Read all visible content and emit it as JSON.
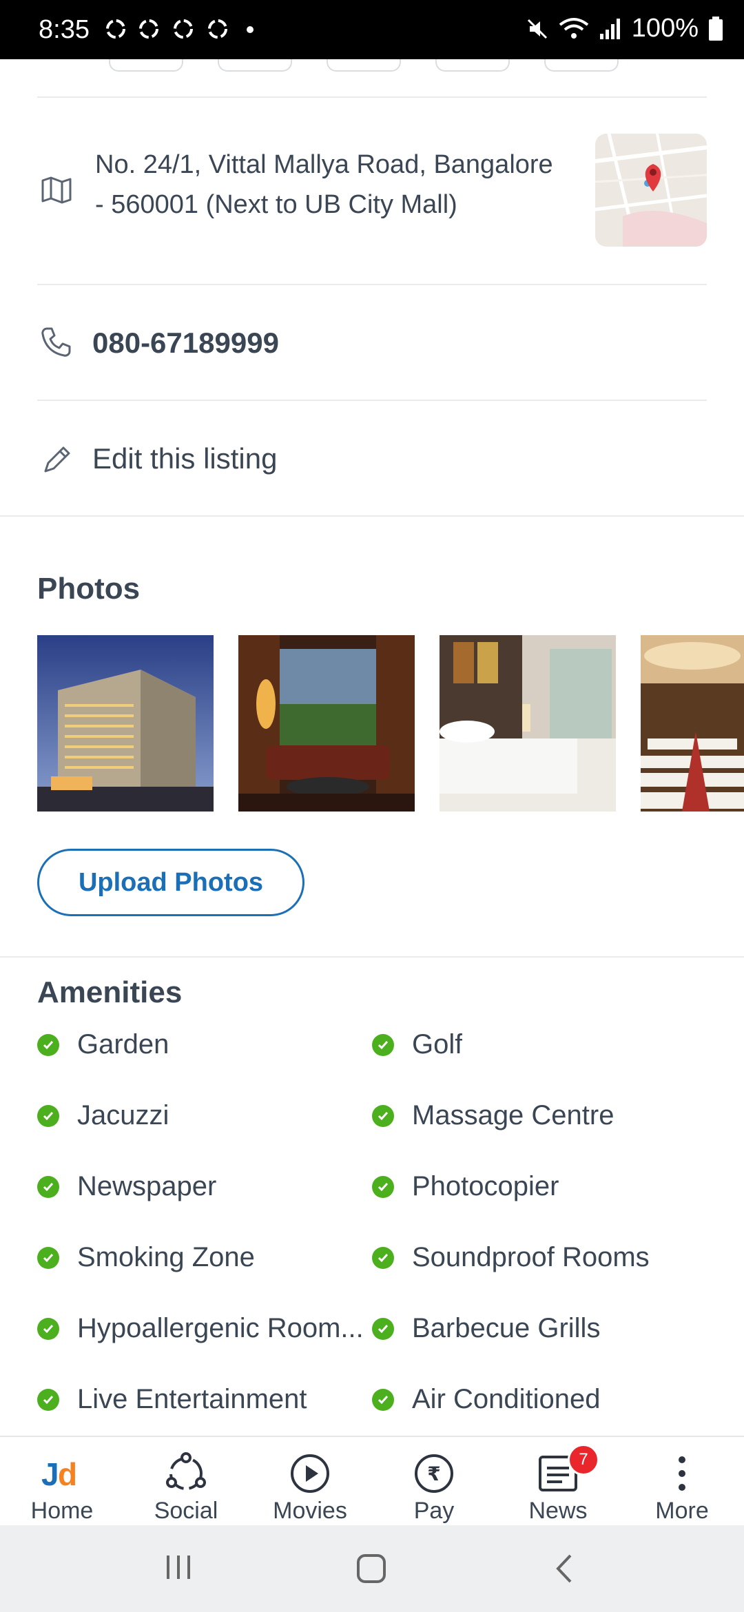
{
  "status_bar": {
    "time": "8:35",
    "battery": "100%"
  },
  "listing": {
    "address_line1": "No. 24/1, Vittal Mallya Road, Bangalore",
    "address_line2": "- 560001 (Next to UB City Mall)",
    "phone": "080-67189999",
    "edit_label": "Edit this listing"
  },
  "photos": {
    "title": "Photos",
    "items": [
      "hotel-exterior",
      "lounge-window",
      "bedroom",
      "banquet-hall"
    ],
    "upload_label": "Upload Photos"
  },
  "amenities": {
    "title": "Amenities",
    "left": [
      "Garden",
      "Jacuzzi",
      "Newspaper",
      "Smoking Zone",
      "Hypoallergenic Room...",
      "Live Entertainment"
    ],
    "right": [
      "Golf",
      "Massage Centre",
      "Photocopier",
      "Soundproof Rooms",
      "Barbecue Grills",
      "Air Conditioned"
    ]
  },
  "bottom_nav": {
    "items": [
      {
        "label": "Home",
        "icon": "jd-logo-icon"
      },
      {
        "label": "Social",
        "icon": "social-icon"
      },
      {
        "label": "Movies",
        "icon": "play-icon"
      },
      {
        "label": "Pay",
        "icon": "rupee-icon"
      },
      {
        "label": "News",
        "icon": "news-icon",
        "badge": "7"
      },
      {
        "label": "More",
        "icon": "more-vertical-icon"
      }
    ]
  },
  "colors": {
    "accent": "#1a6fb7",
    "check": "#4caf1e",
    "badge": "#e8262b",
    "text": "#3b4655"
  }
}
